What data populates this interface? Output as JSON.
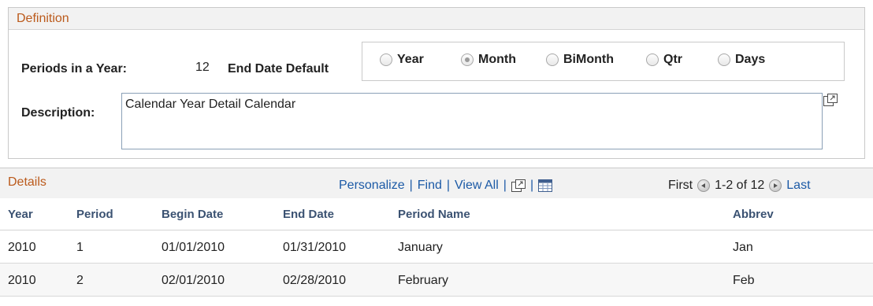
{
  "definition": {
    "title": "Definition",
    "periods_label": "Periods in a Year:",
    "periods_value": "12",
    "end_date_label": "End Date Default",
    "radios": [
      {
        "label": "Year",
        "selected": false
      },
      {
        "label": "Month",
        "selected": true
      },
      {
        "label": "BiMonth",
        "selected": false
      },
      {
        "label": "Qtr",
        "selected": false
      },
      {
        "label": "Days",
        "selected": false
      }
    ],
    "description_label": "Description:",
    "description_value": "Calendar Year Detail Calendar"
  },
  "details": {
    "title": "Details",
    "links": {
      "personalize": "Personalize",
      "find": "Find",
      "view_all": "View All",
      "separator": "|"
    },
    "nav": {
      "first": "First",
      "range": "1-2 of 12",
      "last": "Last"
    },
    "columns": [
      "Year",
      "Period",
      "Begin Date",
      "End Date",
      "Period Name",
      "Abbrev"
    ],
    "rows": [
      [
        "2010",
        "1",
        "01/01/2010",
        "01/31/2010",
        "January",
        "Jan"
      ],
      [
        "2010",
        "2",
        "02/01/2010",
        "02/28/2010",
        "February",
        "Feb"
      ]
    ]
  },
  "icons": {
    "expand": "expand-window-icon",
    "grid": "spreadsheet-icon",
    "prev": "previous-arrow-icon",
    "next": "next-arrow-icon"
  },
  "colors": {
    "section_title": "#bb5a1b",
    "link": "#1c5aa6",
    "column_header": "#3b5272"
  }
}
